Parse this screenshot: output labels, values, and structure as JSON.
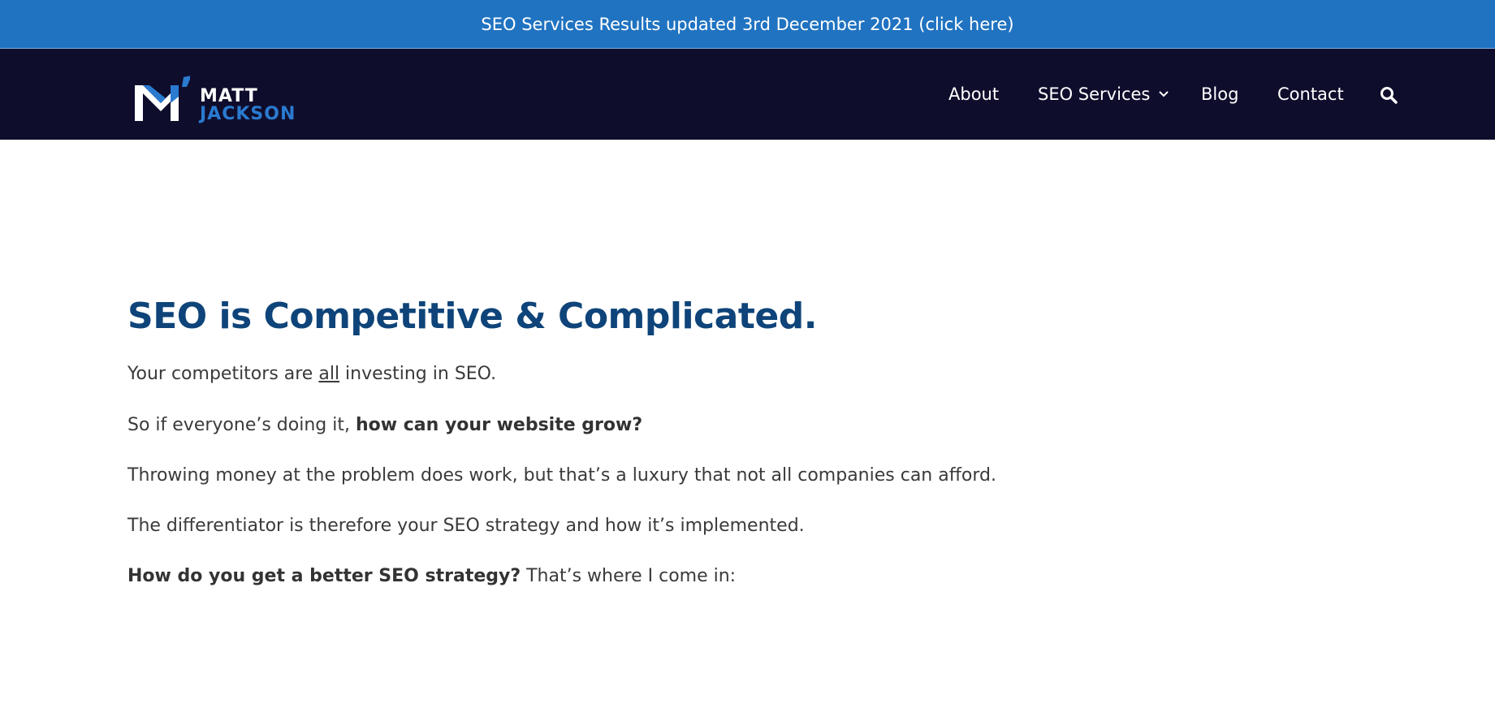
{
  "announcement": {
    "text": "SEO Services Results updated 3rd December 2021 (click here)"
  },
  "header": {
    "logo": {
      "line1": "MATT",
      "line2": "JACKSON"
    },
    "nav": {
      "about": "About",
      "seo_services": "SEO Services",
      "blog": "Blog",
      "contact": "Contact",
      "search_icon": "search-icon",
      "dropdown_icon": "chevron-down-icon"
    }
  },
  "main": {
    "headline": "SEO is Competitive & Complicated.",
    "p1": {
      "before": "Your competitors are ",
      "underlined": "all",
      "after": " investing in SEO."
    },
    "p2": {
      "before": "So if everyone’s doing it, ",
      "bold": "how can your website grow?"
    },
    "p3": "Throwing money at the problem does work, but that’s a luxury that not all companies can afford.",
    "p4": "The differentiator is therefore your SEO strategy and how it’s implemented.",
    "p5": {
      "bold": "How do you get a better SEO strategy?",
      "after": " That’s where I come in:"
    }
  },
  "colors": {
    "announcement_bg": "#2073c1",
    "navbar_bg": "#0f0d2c",
    "headline": "#0e4479",
    "body_text": "#3a3a3a",
    "logo_accent": "#2a7ad0"
  }
}
